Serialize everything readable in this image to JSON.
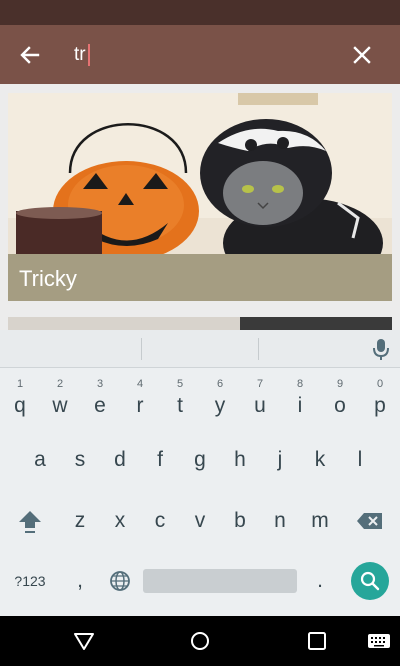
{
  "search": {
    "query": "tr",
    "back_icon": "arrow-back-icon",
    "clear_icon": "close-icon"
  },
  "results": [
    {
      "caption": "Tricky",
      "image": "cat-in-skeleton-hoodie-with-jack-o-lantern"
    }
  ],
  "keyboard": {
    "row1": [
      {
        "key": "q",
        "hint": "1"
      },
      {
        "key": "w",
        "hint": "2"
      },
      {
        "key": "e",
        "hint": "3"
      },
      {
        "key": "r",
        "hint": "4"
      },
      {
        "key": "t",
        "hint": "5"
      },
      {
        "key": "y",
        "hint": "6"
      },
      {
        "key": "u",
        "hint": "7"
      },
      {
        "key": "i",
        "hint": "8"
      },
      {
        "key": "o",
        "hint": "9"
      },
      {
        "key": "p",
        "hint": "0"
      }
    ],
    "row2": [
      "a",
      "s",
      "d",
      "f",
      "g",
      "h",
      "j",
      "k",
      "l"
    ],
    "row3": [
      "z",
      "x",
      "c",
      "v",
      "b",
      "n",
      "m"
    ],
    "symbols_label": "?123",
    "comma": ",",
    "period": ".",
    "shift_icon": "shift-icon",
    "backspace_icon": "backspace-icon",
    "globe_icon": "globe-icon",
    "search_icon": "search-icon",
    "mic_icon": "mic-icon"
  },
  "navigation": {
    "back_icon": "nav-back-triangle-icon",
    "home_icon": "nav-home-circle-icon",
    "recents_icon": "nav-recents-square-icon",
    "keyboard_icon": "keyboard-switcher-icon"
  },
  "colors": {
    "status_bar": "#4a302b",
    "app_bar": "#7a5248",
    "caption_bg": "#a59d82",
    "search_key": "#26a69a",
    "keyboard_bg": "#eceff1"
  }
}
